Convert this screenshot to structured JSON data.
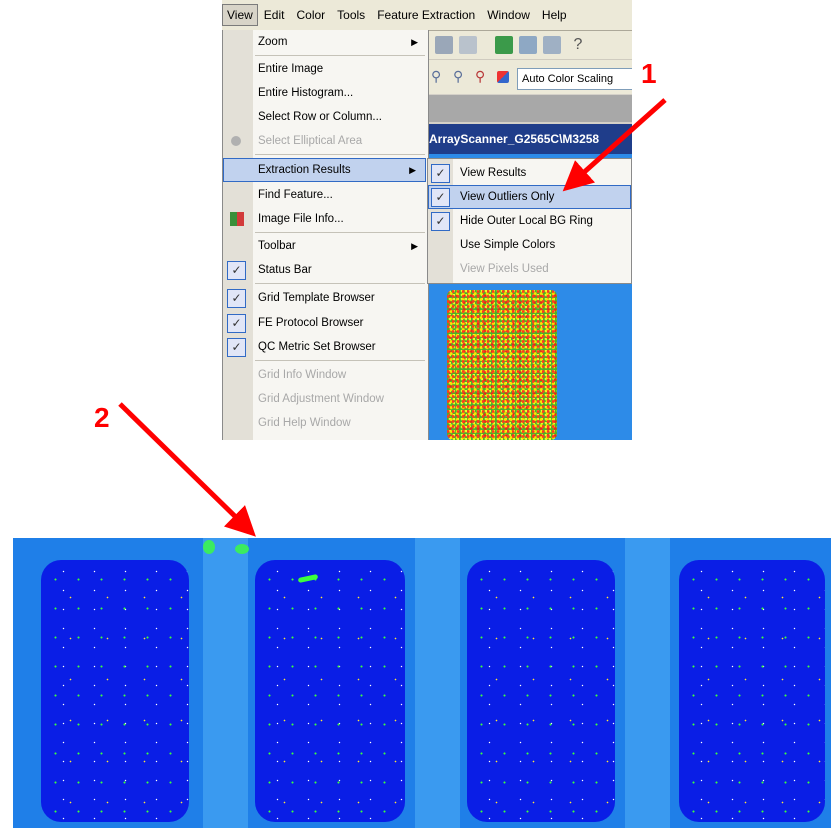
{
  "menubar": {
    "items": [
      "View",
      "Edit",
      "Color",
      "Tools",
      "Feature Extraction",
      "Window",
      "Help"
    ],
    "active_index": 0
  },
  "toolbar": {
    "auto_color_scaling": "Auto Color Scaling"
  },
  "document": {
    "title": "ArrayScanner_G2565C\\M3258"
  },
  "view_menu": {
    "items": [
      {
        "label": "Zoom",
        "submenu": true
      },
      {
        "label": "Entire Image"
      },
      {
        "label": "Entire Histogram..."
      },
      {
        "label": "Select Row or Column..."
      },
      {
        "label": "Select Elliptical Area",
        "disabled": true
      },
      {
        "label": "Extraction Results",
        "submenu": true,
        "selected": true
      },
      {
        "label": "Find Feature..."
      },
      {
        "label": "Image File Info..."
      },
      {
        "label": "Toolbar",
        "submenu": true
      },
      {
        "label": "Status Bar",
        "checked": true
      },
      {
        "label": "Grid Template Browser",
        "checked": true
      },
      {
        "label": "FE Protocol Browser",
        "checked": true
      },
      {
        "label": "QC Metric Set Browser",
        "checked": true
      },
      {
        "label": "Grid Info Window",
        "disabled": true
      },
      {
        "label": "Grid Adjustment Window",
        "disabled": true
      },
      {
        "label": "Grid Help Window",
        "disabled": true
      }
    ]
  },
  "extraction_submenu": {
    "items": [
      {
        "label": "View Results",
        "checked": true
      },
      {
        "label": "View Outliers Only",
        "checked": true,
        "selected": true
      },
      {
        "label": "Hide Outer Local BG Ring",
        "checked": true
      },
      {
        "label": "Use Simple Colors"
      },
      {
        "label": "View Pixels Used",
        "disabled": true
      }
    ]
  },
  "annotations": {
    "label_1": "1",
    "label_2": "2",
    "arrow_color": "#ff0000"
  },
  "scan_image": {
    "block_count": 4,
    "colors": {
      "background": "#1f7fe8",
      "block": "#0a1ee6",
      "outlier": "#3cff3c"
    }
  }
}
